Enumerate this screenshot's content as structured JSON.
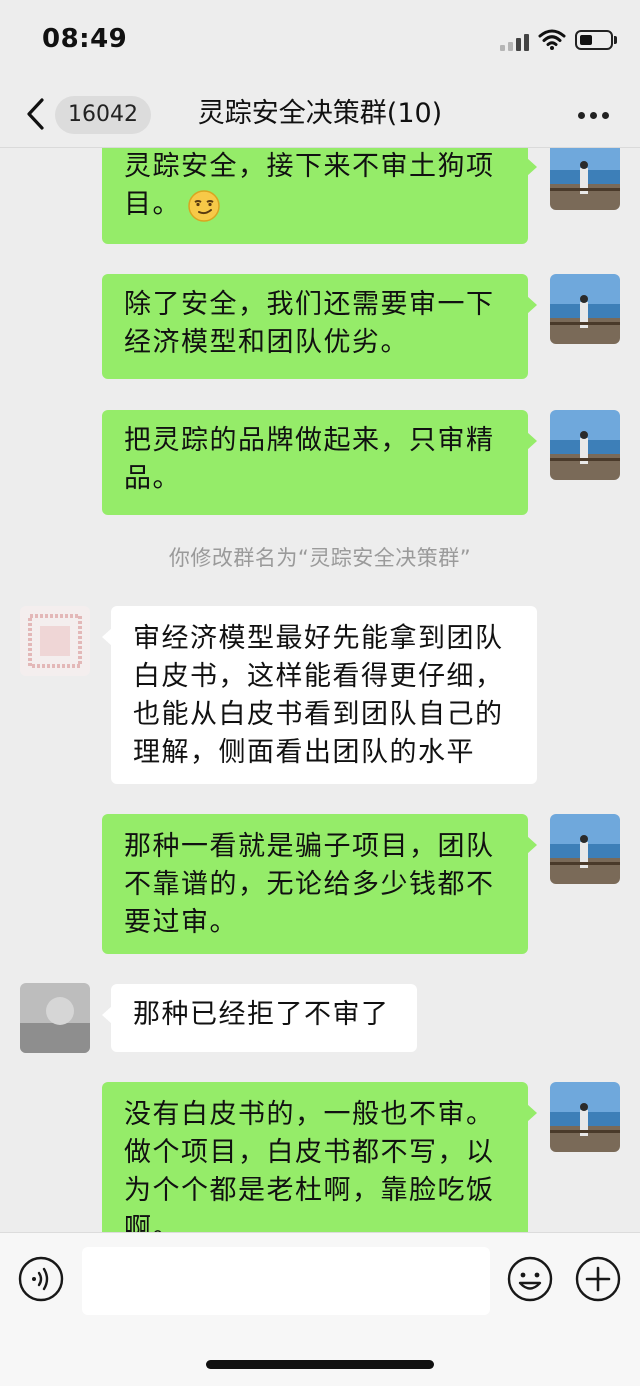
{
  "status_bar": {
    "time": "08:49"
  },
  "nav": {
    "unread_count": "16042",
    "title": "灵踪安全决策群(10)"
  },
  "messages": [
    {
      "sender": "self",
      "text": "灵踪安全，接下来不审土狗项目。",
      "emoji": "smirk-emoji"
    },
    {
      "sender": "self",
      "text": "除了安全，我们还需要审一下经济模型和团队优劣。"
    },
    {
      "sender": "self",
      "text": "把灵踪的品牌做起来，只审精品。"
    },
    {
      "sender": "system",
      "text": "你修改群名为“灵踪安全决策群”"
    },
    {
      "sender": "other",
      "text": "审经济模型最好先能拿到团队白皮书，这样能看得更仔细，也能从白皮书看到团队自己的理解，侧面看出团队的水平"
    },
    {
      "sender": "self",
      "text": "那种一看就是骗子项目，团队不靠谱的，无论给多少钱都不要过审。"
    },
    {
      "sender": "other",
      "text": "那种已经拒了不审了"
    },
    {
      "sender": "self",
      "text": "没有白皮书的，一般也不审。做个项目，白皮书都不写，以为个个都是老杜啊，靠脸吃饭啊。"
    }
  ],
  "input": {
    "placeholder": "",
    "value": ""
  },
  "icons": {
    "back": "chevron-left-icon",
    "more": "more-dots-icon",
    "voice": "voice-icon",
    "emoji": "emoji-icon",
    "plus": "plus-icon"
  },
  "colors": {
    "self_bubble": "#95ec69",
    "other_bubble": "#ffffff",
    "background": "#ededed"
  }
}
